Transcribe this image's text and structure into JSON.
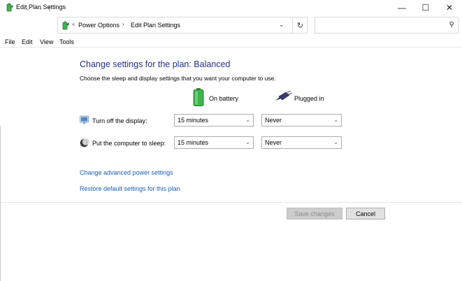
{
  "window": {
    "title": "Edit Plan Settings",
    "controls": {
      "minimize": "—",
      "maximize": "☐",
      "close": "✕"
    }
  },
  "nav": {
    "back_icon": "arrow-left",
    "forward_icon": "arrow-right",
    "up_icon": "arrow-up",
    "address": {
      "chevron": "«",
      "breadcrumbs": [
        "Power Options",
        "Edit Plan Settings"
      ],
      "separator": "›"
    },
    "search": {
      "placeholder": ""
    }
  },
  "menu": [
    "File",
    "Edit",
    "View",
    "Tools"
  ],
  "content": {
    "heading": "Change settings for the plan: Balanced",
    "description": "Choose the sleep and display settings that you want your computer to use.",
    "columns": {
      "on_battery": "On battery",
      "plugged_in": "Plugged in"
    },
    "rows": [
      {
        "label": "Turn off the display:",
        "on_battery": "15 minutes",
        "plugged_in": "Never"
      },
      {
        "label": "Put the computer to sleep:",
        "on_battery": "15 minutes",
        "plugged_in": "Never"
      }
    ],
    "links": {
      "advanced": "Change advanced power settings",
      "restore": "Restore default settings for this plan"
    }
  },
  "buttons": {
    "save": "Save changes",
    "cancel": "Cancel"
  },
  "colors": {
    "heading": "#1e3287",
    "link": "#1a5fb4",
    "battery_green": "#3cb44b"
  }
}
